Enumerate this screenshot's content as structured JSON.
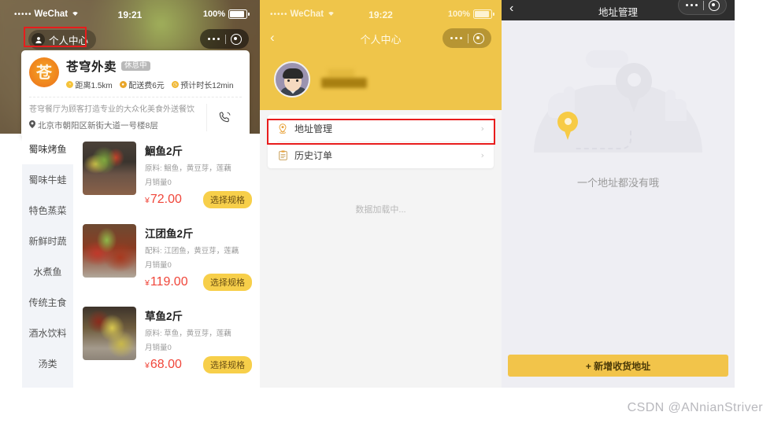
{
  "panel1": {
    "status": {
      "carrier": "WeChat",
      "dots": "•••••",
      "wifi": "⌃",
      "time": "19:21",
      "battery": "100%"
    },
    "nav": {
      "profile_label": "个人中心",
      "profile_icon": "person-icon"
    },
    "shop": {
      "name": "苍穹外卖",
      "status_badge": "休息中",
      "tags": [
        {
          "icon": "distance-icon",
          "text": "距离1.5km"
        },
        {
          "icon": "delivery-fee-icon",
          "text": "配送费6元"
        },
        {
          "icon": "time-icon",
          "text": "预计时长12min"
        }
      ],
      "description": "苍穹餐厅为顾客打造专业的大众化美食外送餐饮",
      "address": "北京市朝阳区新街大道一号楼8层",
      "phone_icon": "phone-icon"
    },
    "categories": [
      {
        "label": "蜀味烤鱼",
        "active": true
      },
      {
        "label": "蜀味牛蛙",
        "active": false
      },
      {
        "label": "特色蒸菜",
        "active": false
      },
      {
        "label": "新鲜时蔬",
        "active": false
      },
      {
        "label": "水煮鱼",
        "active": false
      },
      {
        "label": "传统主食",
        "active": false
      },
      {
        "label": "酒水饮料",
        "active": false
      },
      {
        "label": "汤类",
        "active": false
      }
    ],
    "dishes": [
      {
        "name": "鮰鱼2斤",
        "ingredients": "原料: 鮰鱼，黄豆芽，莲藕",
        "sales": "月销量0",
        "currency": "¥",
        "price": "72.00",
        "spec_label": "选择规格"
      },
      {
        "name": "江团鱼2斤",
        "ingredients": "配料: 江团鱼，黄豆芽，莲藕",
        "sales": "月销量0",
        "currency": "¥",
        "price": "119.00",
        "spec_label": "选择规格"
      },
      {
        "name": "草鱼2斤",
        "ingredients": "原料: 草鱼，黄豆芽，莲藕",
        "sales": "月销量0",
        "currency": "¥",
        "price": "68.00",
        "spec_label": "选择规格"
      }
    ]
  },
  "panel2": {
    "status": {
      "carrier": "WeChat",
      "dots": "•••••",
      "wifi": "⌃",
      "time": "19:22",
      "battery": "100%"
    },
    "nav": {
      "back_icon": "chevron-left-icon",
      "title": "个人中心"
    },
    "user": {
      "name": "",
      "avatar": "user-avatar"
    },
    "menu": [
      {
        "icon": "location-pin-icon",
        "label": "地址管理",
        "arrow": "›"
      },
      {
        "icon": "clipboard-icon",
        "label": "历史订单",
        "arrow": "›"
      }
    ],
    "loading_text": "数据加载中..."
  },
  "panel3": {
    "nav": {
      "back_icon": "chevron-left-icon",
      "title": "地址管理"
    },
    "empty_text": "一个地址都没有哦",
    "add_button": "+ 新增收货地址"
  },
  "watermark": "CSDN @ANnianStriver",
  "colors": {
    "brand_yellow": "#efc54a",
    "button_yellow": "#f2c44a",
    "price_red": "#f0463a",
    "highlight_red": "#e81c1c",
    "dark_nav": "#2e2e2e"
  }
}
